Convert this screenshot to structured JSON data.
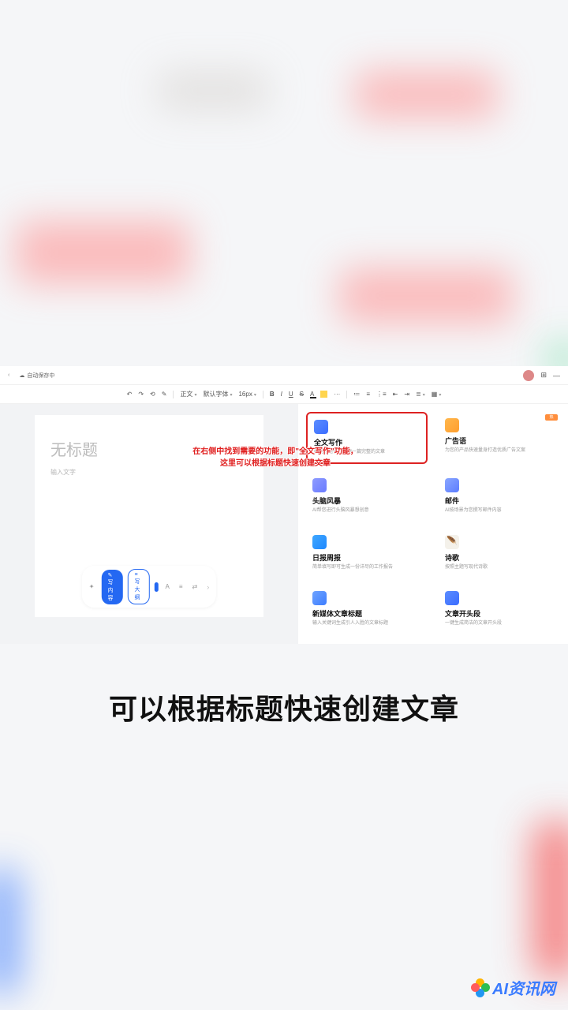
{
  "topbar": {
    "back_label": "‹",
    "doc_name_blur": " ",
    "autosave": "自动保存中",
    "grid_icon": "⊞",
    "min_icon": "—"
  },
  "toolbar": {
    "undo": "↶",
    "redo": "↷",
    "format": "⟲",
    "brush": "✎",
    "para": "正文",
    "font": "默认字体",
    "size": "16px",
    "bold": "B",
    "italic": "I",
    "underline": "U",
    "strike": "S",
    "color": "A",
    "more": "···",
    "list1": "≔",
    "list2": "≡",
    "list3": "⋮≡",
    "indent1": "⇤",
    "indent2": "⇥",
    "align": "≣",
    "table": "▦"
  },
  "doc": {
    "title_placeholder": "无标题",
    "body_placeholder": "输入文字"
  },
  "doc_footer": {
    "continue": "✎ 写内容",
    "outline": "≡ 写大纲",
    "a": "A",
    "b": "≡",
    "c": "⇄",
    "next": "›"
  },
  "cards": [
    {
      "title": "全文写作",
      "desc": "根据标题快速创建一篇完整的文章",
      "icon": "ico-doc",
      "highlighted": true
    },
    {
      "title": "广告语",
      "desc": "为您的产品快速量身打造优质广告文案",
      "icon": "ico-ad",
      "corner": "热"
    },
    {
      "title": "头脑风暴",
      "desc": "AI帮您进行头脑风暴想创意",
      "icon": "ico-brain"
    },
    {
      "title": "邮件",
      "desc": "AI按场景为您撰写邮件内容",
      "icon": "ico-mail"
    },
    {
      "title": "日报周报",
      "desc": "简单填写即可生成一份详尽的工作报告",
      "icon": "ico-report"
    },
    {
      "title": "诗歌",
      "desc": "按照主题写现代诗歌",
      "icon": "ico-poem"
    },
    {
      "title": "新媒体文章标题",
      "desc": "输入关键词生成引人入胜的文章标题",
      "icon": "ico-media"
    },
    {
      "title": "文章开头段",
      "desc": "一键生成简洁的文章开头段",
      "icon": "ico-para"
    },
    {
      "title": "",
      "desc": "",
      "icon": "ico-red"
    },
    {
      "title": "",
      "desc": "",
      "icon": "ico-red"
    }
  ],
  "annotation": {
    "line1": "在右侧中找到需要的功能，即\"全文写作\"功能，",
    "line2": "这里可以根据标题快速创建文章"
  },
  "caption": "可以根据标题快速创建文章",
  "watermark": "AI资讯网"
}
